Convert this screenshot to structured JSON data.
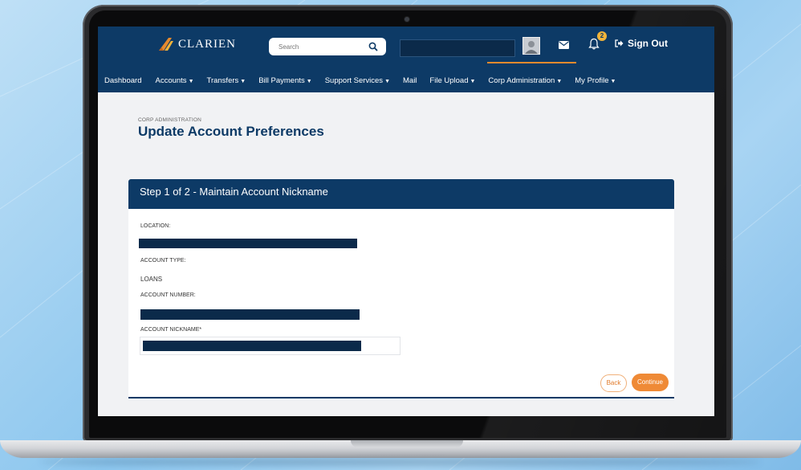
{
  "brand": {
    "name": "CLARIEN"
  },
  "header": {
    "search_placeholder": "Search",
    "notification_count": "2",
    "signout_label": "Sign Out"
  },
  "nav": {
    "items": [
      {
        "label": "Dashboard",
        "caret": false
      },
      {
        "label": "Accounts",
        "caret": true
      },
      {
        "label": "Transfers",
        "caret": true
      },
      {
        "label": "Bill Payments",
        "caret": true
      },
      {
        "label": "Support Services",
        "caret": true
      },
      {
        "label": "Mail",
        "caret": false
      },
      {
        "label": "File Upload",
        "caret": true
      },
      {
        "label": "Corp Administration",
        "caret": true
      },
      {
        "label": "My Profile",
        "caret": true
      }
    ]
  },
  "page": {
    "breadcrumb": "CORP ADMINISTRATION",
    "title": "Update Account Preferences"
  },
  "form": {
    "step_title": "Step 1 of 2 - Maintain Account Nickname",
    "location_label": "LOCATION:",
    "account_type_label": "ACCOUNT TYPE:",
    "account_type_value": "LOANS",
    "account_number_label": "ACCOUNT NUMBER:",
    "nickname_label": "ACCOUNT NICKNAME*",
    "back_label": "Back",
    "continue_label": "Continue"
  },
  "colors": {
    "header_navy": "#0d3a66",
    "accent_orange": "#ef8a36",
    "badge_yellow": "#f2b43a",
    "redaction": "#0b2a4a"
  }
}
